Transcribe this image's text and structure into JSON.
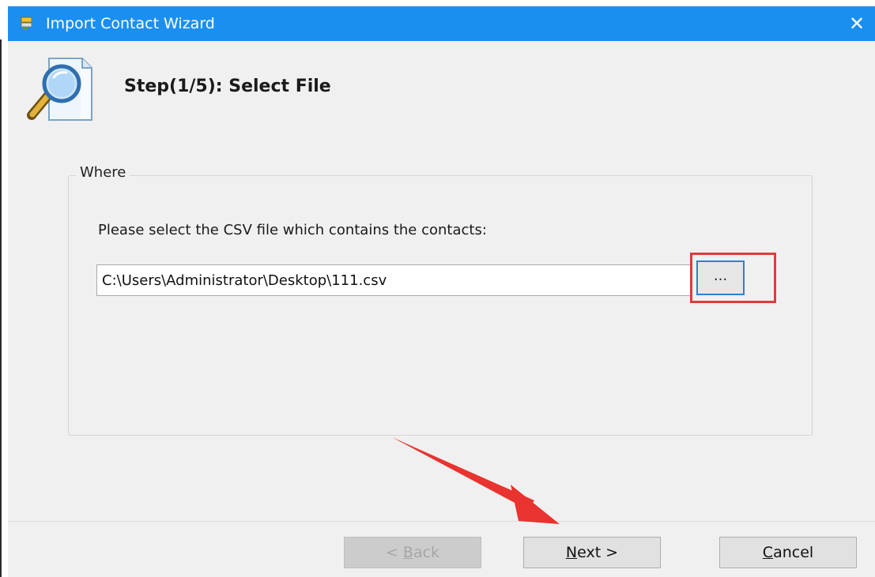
{
  "window": {
    "title": "Import Contact Wizard",
    "close_glyph": "✕"
  },
  "header": {
    "step_title": "Step(1/5): Select File"
  },
  "group": {
    "legend": "Where",
    "prompt": "Please select the CSV file which contains the contacts:",
    "file_path": "C:\\Users\\Administrator\\Desktop\\111.csv",
    "browse_label": "..."
  },
  "buttons": {
    "back": {
      "prefix": "< ",
      "mnemonic": "B",
      "rest": "ack",
      "enabled": false
    },
    "next": {
      "prefix": "",
      "mnemonic": "N",
      "rest": "ext >",
      "enabled": true
    },
    "cancel": {
      "prefix": "",
      "mnemonic": "C",
      "rest": "ancel",
      "enabled": true
    }
  },
  "colors": {
    "titlebar": "#1b8ff0",
    "annotation": "#e23a3a"
  },
  "icons": {
    "title": "wizard-app-icon",
    "header": "magnifier-document-icon"
  }
}
